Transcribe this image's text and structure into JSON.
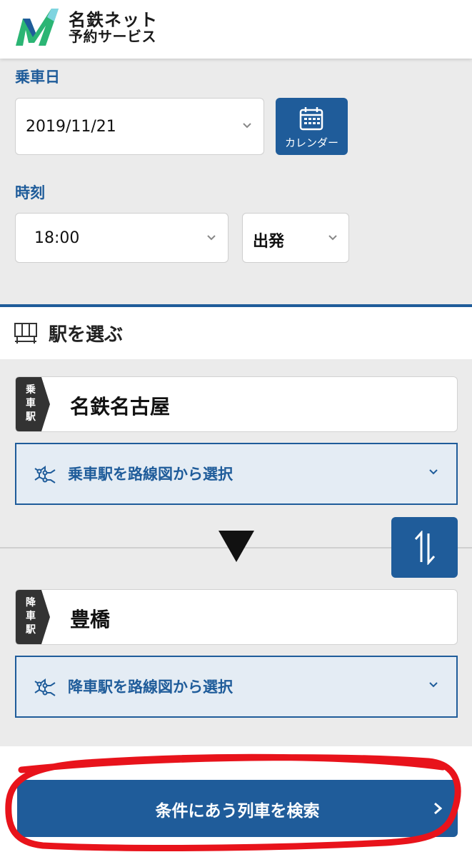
{
  "header": {
    "logo_line1": "名鉄ネット",
    "logo_line2": "予約サービス"
  },
  "date": {
    "label": "乗車日",
    "value": "2019/11/21",
    "calendar_label": "カレンダー"
  },
  "time": {
    "label": "時刻",
    "value": "18:00",
    "mode": "出発"
  },
  "station_section": {
    "title": "駅を選ぶ"
  },
  "departure": {
    "tag": "乗車駅",
    "name": "名鉄名古屋",
    "route_label": "乗車駅を路線図から選択"
  },
  "arrival": {
    "tag": "降車駅",
    "name": "豊橋",
    "route_label": "降車駅を路線図から選択"
  },
  "search": {
    "label": "条件にあう列車を検索"
  },
  "colors": {
    "brand_blue": "#1f5c9a",
    "logo_green": "#2bb574",
    "highlight_red": "#e8131b"
  },
  "icons": {
    "calendar": "calendar-icon",
    "station": "station-sign-icon",
    "route": "route-map-icon",
    "swap": "swap-arrows-icon",
    "direction": "down-triangle-icon"
  }
}
